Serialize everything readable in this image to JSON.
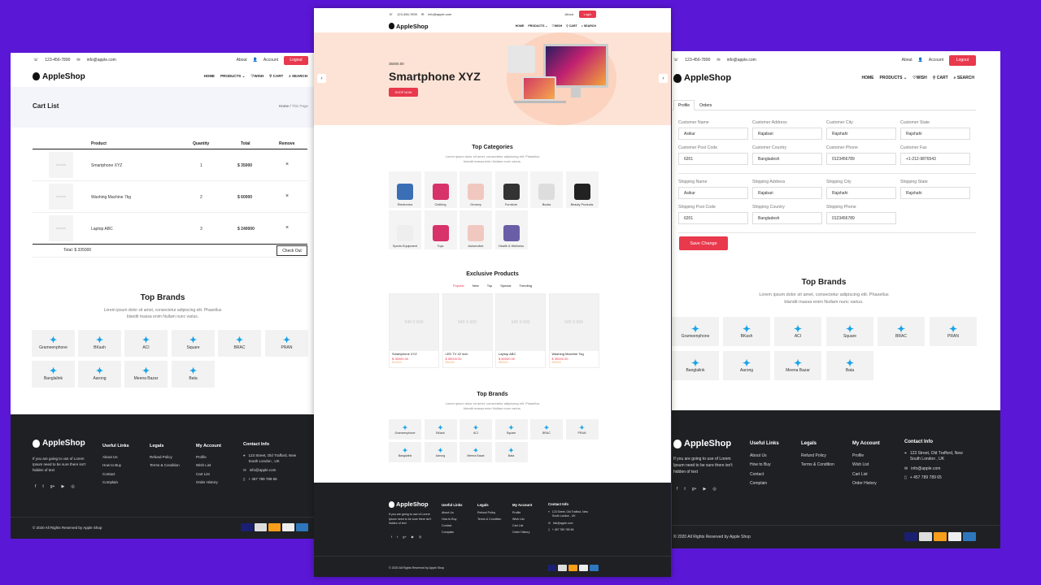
{
  "brand": {
    "name": "AppleShop"
  },
  "contact": {
    "phone": "123-456-7890",
    "email": "info@apple.com"
  },
  "topbar": {
    "about": "About",
    "account": "Account",
    "logout": "Logout",
    "login": "Login"
  },
  "nav": {
    "home": "HOME",
    "products": "PRODUCTS",
    "wish": "WISH",
    "cart": "CART",
    "search": "SEARCH"
  },
  "cart_page": {
    "title": "Cart List",
    "breadcrumb_home": "Home",
    "breadcrumb_sep": "/",
    "breadcrumb_current": "This Page",
    "columns": [
      "Product",
      "Quantity",
      "Total",
      "Remove"
    ],
    "rows": [
      {
        "thumb": "540X600",
        "name": "Smartphone XYZ",
        "qty": "1",
        "total": "$ 35000",
        "remove": "×"
      },
      {
        "thumb": "540X600",
        "name": "Washing Machine 7kg",
        "qty": "2",
        "total": "$ 60000",
        "remove": "×"
      },
      {
        "thumb": "540X600",
        "name": "Laptop ABC",
        "qty": "3",
        "total": "$ 240000",
        "remove": "×"
      }
    ],
    "grand_total": "Total: $ 335000",
    "checkout": "Check Out"
  },
  "brands": {
    "title": "Top Brands",
    "desc_line1": "Lorem ipsum dolor sit amet, consectetur adipiscing elit. Phasellus",
    "desc_line2": "blandit massa enim Nullam nunc varius.",
    "items": [
      "Grameenphone",
      "BKash",
      "ACI",
      "Square",
      "BRAC",
      "PRAN",
      "Banglalink",
      "Aarong",
      "Meena Bazar",
      "Bata"
    ],
    "icon": "brand-logo-icon"
  },
  "home": {
    "hero_price": "35000.00",
    "hero_title": "Smartphone XYZ",
    "hero_button": "SHOP NOW",
    "categories_title": "Top Categories",
    "categories_desc_line1": "Lorem ipsum dolor sit amet, consectetur adipiscing elit. Phasellus",
    "categories_desc_line2": "blandit massa enim Nullam nunc varius.",
    "categories": [
      "Electronics",
      "Clothing",
      "Grocery",
      "Furniture",
      "Books",
      "Beauty Products",
      "Sports Equipment",
      "Toys",
      "Automotive",
      "Health & Wellness"
    ],
    "exclusive_title": "Exclusive Products",
    "tabs": [
      "Popular",
      "New",
      "Top",
      "Special",
      "Trending"
    ],
    "products": [
      {
        "img": "540 X 600",
        "name": "Smartphone XYZ",
        "price": "$ 35000.00",
        "old": "$40000"
      },
      {
        "img": "540 X 600",
        "name": "LED TV 42 inch",
        "price": "$ 55000.00",
        "old": "$60000"
      },
      {
        "img": "540 X 600",
        "name": "Laptop ABC",
        "price": "$ 80000.00",
        "old": "$85000"
      },
      {
        "img": "540 X 600",
        "name": "Washing Machine 7kg",
        "price": "$ 30000.00",
        "old": "$35000"
      }
    ]
  },
  "profile": {
    "tabs": [
      "Profile",
      "Orders"
    ],
    "fields": [
      {
        "label": "Customer Name",
        "value": "Asikur"
      },
      {
        "label": "Customer Address",
        "value": "Rajabari"
      },
      {
        "label": "Customer City",
        "value": "Rajshahi"
      },
      {
        "label": "Customer State",
        "value": "Rajshahi"
      },
      {
        "label": "Customer Post Code",
        "value": "6201"
      },
      {
        "label": "Customer Country",
        "value": "Bangladesh"
      },
      {
        "label": "Customer Phone",
        "value": "0123456789"
      },
      {
        "label": "Customer Fax",
        "value": "+1-212-9876543"
      },
      {
        "label": "Shipping Name",
        "value": "Asikur"
      },
      {
        "label": "Shipping Address",
        "value": "Rajabari"
      },
      {
        "label": "Shipping City",
        "value": "Rajshahi"
      },
      {
        "label": "Shipping State",
        "value": "Rajshahi"
      },
      {
        "label": "Shipping Post Code",
        "value": "6201"
      },
      {
        "label": "Shipping Country",
        "value": "Bangladesh"
      },
      {
        "label": "Shipping Phone",
        "value": "0123456789"
      }
    ],
    "save": "Save Change"
  },
  "footer": {
    "about_line1": "If you are going to use of Lorem",
    "about_line2": "Ipsum need to be sure there isn't",
    "about_line3": "hidden of text",
    "useful_title": "Useful Links",
    "useful": [
      "About Us",
      "How to Buy",
      "Contact",
      "Complain"
    ],
    "legals_title": "Legals",
    "legals": [
      "Refund Policy",
      "Terms & Condition"
    ],
    "account_title": "My Account",
    "account": [
      "Profile",
      "Wish List",
      "Cart List",
      "Order History"
    ],
    "contact_title": "Contact Info",
    "address_line1": "123 Street, Old Trafford, New",
    "address_line2": "South London , UK",
    "email": "info@apple.com",
    "phone": "+ 457 789 789 65",
    "copyright": "© 2020 All Rights Reserved by Apple Shop",
    "payments": [
      "VISA",
      "DISCOVER",
      "MASTERCARD",
      "PAYPAL",
      "AMEX"
    ]
  },
  "colors": {
    "accent": "#e8394d",
    "background": "#5b17d6",
    "footer": "#1e2023",
    "brand_icon": "#1aa3e8",
    "hero": "#fde3d6"
  }
}
